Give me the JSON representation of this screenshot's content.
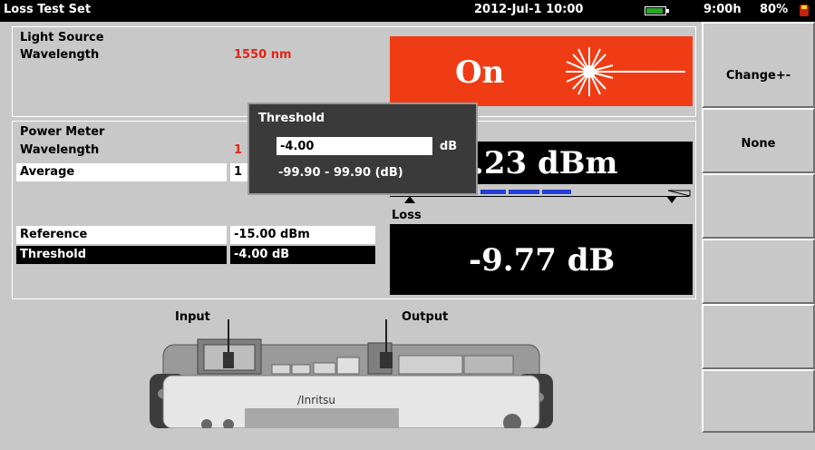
{
  "titlebar": {
    "title": "Loss Test Set",
    "datetime": "2012-Jul-1 10:00",
    "remaining": "9:00h",
    "battery_percent": "80%"
  },
  "light_source": {
    "section_label": "Light Source",
    "wavelength_label": "Wavelength",
    "wavelength_value": "1550 nm",
    "state": "On",
    "state_color": "#f03c14"
  },
  "power_meter": {
    "section_label": "Power Meter",
    "wavelength_label": "Wavelength",
    "wavelength_value_partial": "1",
    "average_label": "Average",
    "average_value_partial": "1",
    "reading_partial": ".23 dBm",
    "reference_label": "Reference",
    "reference_value": "-15.00 dBm",
    "threshold_label": "Threshold",
    "threshold_value": "-4.00 dB"
  },
  "loss": {
    "label": "Loss",
    "value": "-9.77 dB"
  },
  "popup": {
    "title": "Threshold",
    "input_value": "-4.00",
    "unit": "dB",
    "range": "-99.90 - 99.90 (dB)"
  },
  "diagram": {
    "input_label": "Input",
    "output_label": "Output",
    "brand": "/Inritsu"
  },
  "sidebar": {
    "buttons": [
      "Change+-",
      "None",
      "",
      "",
      "",
      ""
    ]
  },
  "colors": {
    "accent_red": "#e42414",
    "bar_blue": "#2440d8"
  }
}
